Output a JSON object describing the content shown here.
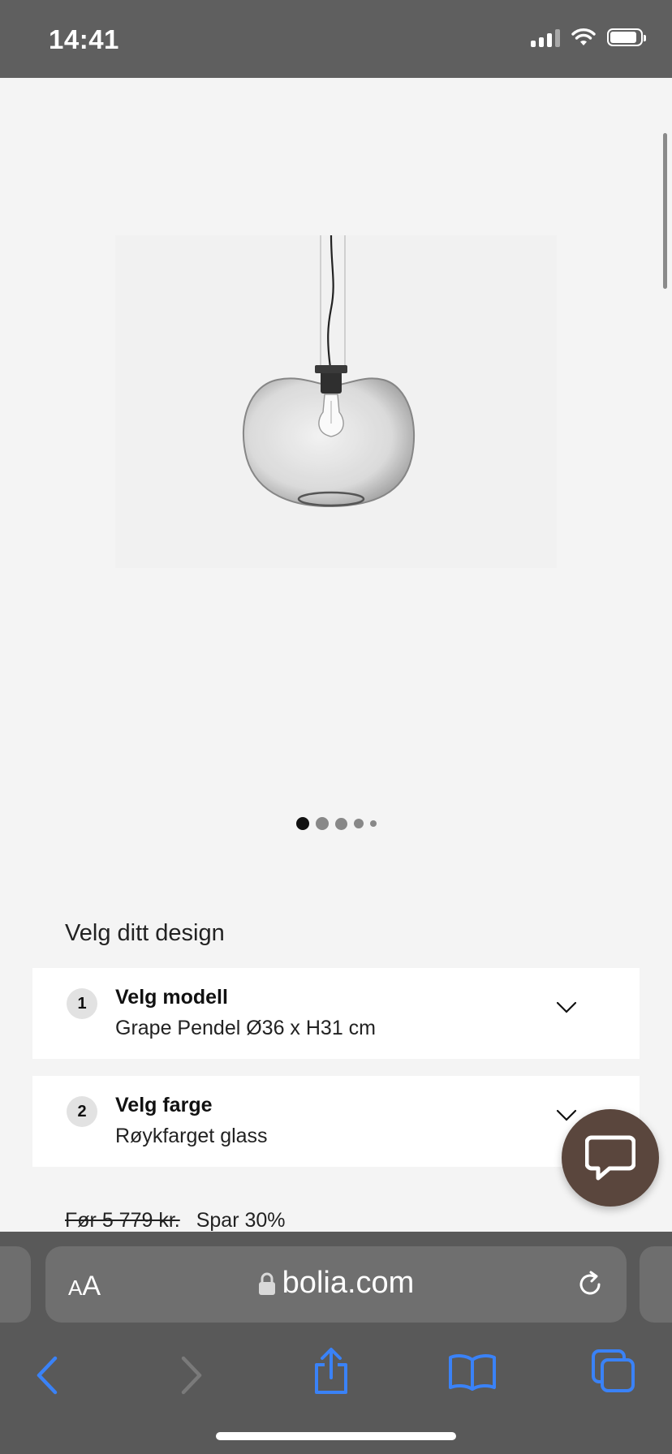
{
  "status_bar": {
    "time": "14:41"
  },
  "design": {
    "title": "Velg ditt design",
    "options": [
      {
        "number": "1",
        "label": "Velg modell",
        "value": "Grape Pendel Ø36 x H31 cm"
      },
      {
        "number": "2",
        "label": "Velg farge",
        "value": "Røykfarget glass"
      }
    ]
  },
  "price": {
    "old": "Før 5 779 kr.",
    "save": "Spar 30%"
  },
  "carousel": {
    "count": 5,
    "active_index": 0
  },
  "browser": {
    "text_size_label_small": "A",
    "text_size_label_large": "A",
    "url": "bolia.com"
  },
  "icons": {
    "chat": "chat-bubble-icon",
    "back": "back-arrow-icon",
    "forward": "forward-arrow-icon",
    "share": "share-icon",
    "bookmarks": "bookmarks-icon",
    "tabs": "tabs-icon",
    "reload": "reload-icon",
    "lock": "lock-icon"
  },
  "colors": {
    "status_bar": "#5f5f5f",
    "chat_button": "#5a463d",
    "safari_accent": "#3a82f7",
    "page_bg": "#f4f4f4"
  }
}
